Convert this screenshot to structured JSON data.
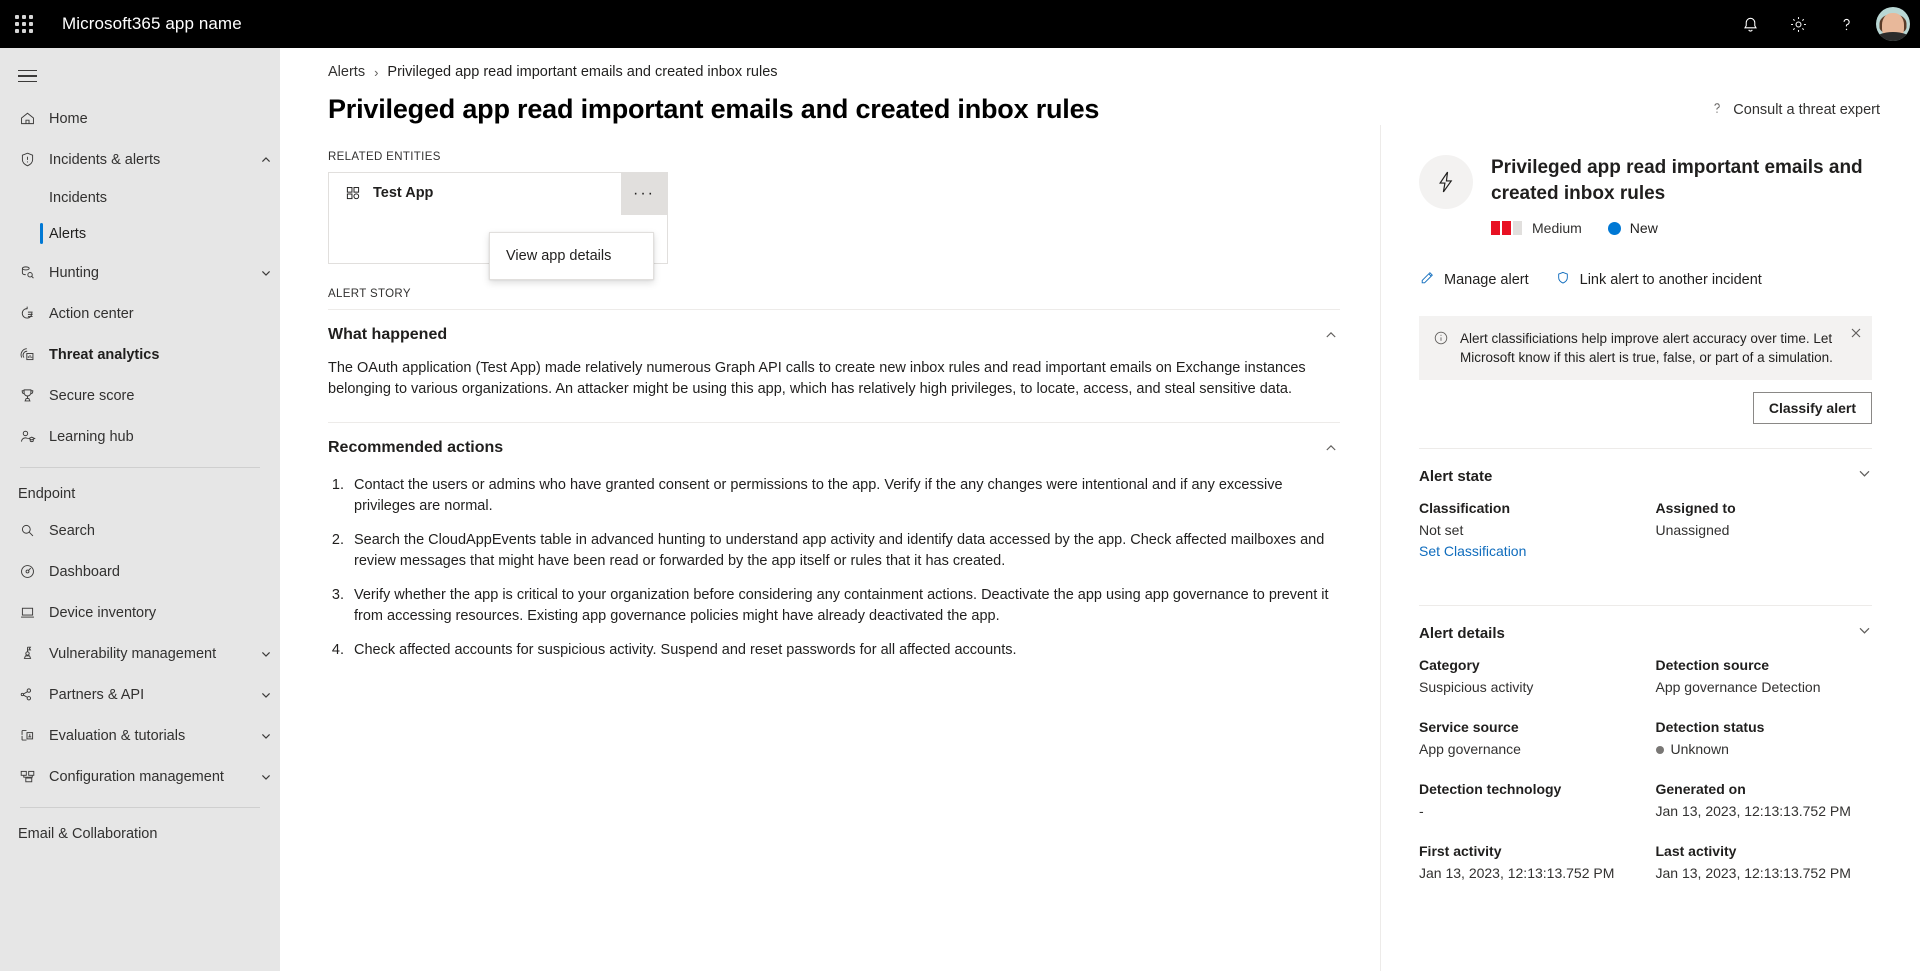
{
  "topbar": {
    "brand": "Microsoft365 app name",
    "waffle_icon": "app-launcher-icon",
    "icons": [
      {
        "name": "notification-bell-icon",
        "label": "Notifications"
      },
      {
        "name": "gear-icon",
        "label": "Settings"
      },
      {
        "name": "help-question-icon",
        "label": "Help"
      }
    ],
    "avatar_label": "Account manager"
  },
  "sidebar": {
    "hamburger_label": "Collapse navigation",
    "items": [
      {
        "label": "Home",
        "icon": "home-icon",
        "kind": "item"
      },
      {
        "label": "Incidents & alerts",
        "icon": "shield-alert-icon",
        "kind": "expandable",
        "chevron": "chevron-up-icon"
      },
      {
        "label": "Incidents",
        "kind": "sub"
      },
      {
        "label": "Alerts",
        "kind": "sub",
        "active": true
      },
      {
        "label": "Hunting",
        "icon": "hunting-icon",
        "kind": "expandable",
        "chevron": "chevron-down-icon"
      },
      {
        "label": "Action center",
        "icon": "action-center-icon",
        "kind": "item"
      },
      {
        "label": "Threat analytics",
        "icon": "threat-analytics-icon",
        "kind": "item",
        "bold": true
      },
      {
        "label": "Secure score",
        "icon": "trophy-icon",
        "kind": "item"
      },
      {
        "label": "Learning hub",
        "icon": "learning-hub-icon",
        "kind": "item"
      }
    ],
    "endpoint_section": "Endpoint",
    "endpoint_items": [
      {
        "label": "Search",
        "icon": "search-icon",
        "kind": "item"
      },
      {
        "label": "Dashboard",
        "icon": "dashboard-icon",
        "kind": "item"
      },
      {
        "label": "Device inventory",
        "icon": "device-icon",
        "kind": "item"
      },
      {
        "label": "Vulnerability management",
        "icon": "vulnerability-icon",
        "kind": "expandable",
        "chevron": "chevron-down-icon"
      },
      {
        "label": "Partners & API",
        "icon": "partners-api-icon",
        "kind": "expandable",
        "chevron": "chevron-down-icon"
      },
      {
        "label": "Evaluation & tutorials",
        "icon": "evaluation-icon",
        "kind": "expandable",
        "chevron": "chevron-down-icon"
      },
      {
        "label": "Configuration management",
        "icon": "configuration-icon",
        "kind": "expandable",
        "chevron": "chevron-down-icon"
      }
    ],
    "email_section": "Email & Collaboration"
  },
  "breadcrumb": {
    "root": "Alerts",
    "separator": "›",
    "current": "Privileged app read important emails and created inbox rules"
  },
  "page": {
    "title": "Privileged app read important emails and created inbox rules",
    "consult_label": "Consult a threat expert",
    "consult_icon": "help-question-icon"
  },
  "related_entities": {
    "caption": "RELATED ENTITIES",
    "entity_name": "Test App",
    "entity_icon": "app-entity-icon",
    "ellipsis_label": "···",
    "menu": {
      "items": [
        "View app details"
      ]
    }
  },
  "alert_story": {
    "caption": "ALERT STORY",
    "what_happened": {
      "title": "What happened",
      "chevron": "chevron-up-icon",
      "body": "The OAuth application (Test App) made relatively numerous Graph API calls to create new inbox rules and read important emails on Exchange instances belonging to various organizations. An attacker might be using this app, which has relatively high privileges, to locate, access, and steal sensitive data."
    },
    "recommended_actions": {
      "title": "Recommended actions",
      "chevron": "chevron-up-icon",
      "items": [
        "Contact the users or admins who have granted consent or permissions to the app. Verify if the any changes were intentional and if any excessive privileges are normal.",
        "Search the CloudAppEvents table in advanced hunting to understand app activity and identify data accessed by the app. Check affected mailboxes and review messages that might have been read or forwarded by the app itself or rules that it has created.",
        "Verify whether the app is critical to your organization before considering any containment actions. Deactivate the app using app governance to prevent it from accessing resources. Existing app governance policies might have already deactivated the app.",
        "Check affected accounts for suspicious activity. Suspend and reset passwords for all affected accounts."
      ]
    }
  },
  "detail_pane": {
    "icon": "lightning-bolt-icon",
    "title": "Privileged app read important emails and created inbox rules",
    "severity": {
      "label": "Medium",
      "filled": 2,
      "total": 3,
      "color": "#e81123",
      "empty_color": "#e1dfdd"
    },
    "status": {
      "label": "New",
      "color": "#0078d4"
    },
    "actions": [
      {
        "label": "Manage alert",
        "icon": "pencil-icon"
      },
      {
        "label": "Link alert to another incident",
        "icon": "shield-link-icon"
      }
    ],
    "message_bar": {
      "icon": "info-circle-icon",
      "text": "Alert classificiations help improve alert accuracy over time. Let Microsoft know if this alert is true, false, or part of a simulation.",
      "close_icon": "close-icon",
      "button_label": "Classify alert"
    },
    "alert_state": {
      "title": "Alert state",
      "chevron": "chevron-down-icon",
      "fields": [
        {
          "key": "Classification",
          "value": "Not set",
          "link": "Set Classification"
        },
        {
          "key": "Assigned to",
          "value": "Unassigned"
        }
      ]
    },
    "alert_details": {
      "title": "Alert details",
      "chevron": "chevron-down-icon",
      "fields": [
        {
          "key": "Category",
          "value": "Suspicious activity"
        },
        {
          "key": "Detection source",
          "value": "App governance Detection"
        },
        {
          "key": "Service source",
          "value": "App governance"
        },
        {
          "key": "Detection status",
          "value": "Unknown",
          "dot": true
        },
        {
          "key": "Detection technology",
          "value": "-"
        },
        {
          "key": "Generated on",
          "value": "Jan 13, 2023, 12:13:13.752 PM"
        },
        {
          "key": "First activity",
          "value": "Jan 13, 2023, 12:13:13.752 PM"
        },
        {
          "key": "Last activity",
          "value": "Jan 13, 2023, 12:13:13.752 PM"
        }
      ]
    }
  }
}
